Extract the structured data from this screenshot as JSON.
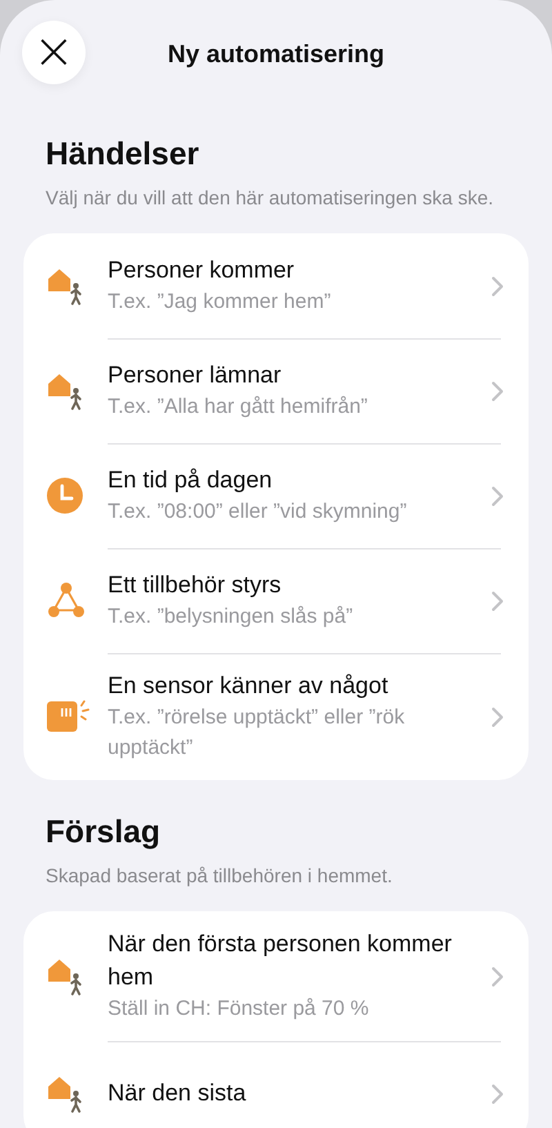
{
  "header": {
    "close_icon": "×",
    "title": "Ny automatisering"
  },
  "sections": [
    {
      "title": "Händelser",
      "subtitle": "Välj när du vill att den här automatiseringen ska ske.",
      "rows": [
        {
          "kind": "person-home",
          "title": "Personer kommer",
          "subtitle": "T.ex. ”Jag kommer hem”"
        },
        {
          "kind": "person-home",
          "title": "Personer lämnar",
          "subtitle": "T.ex. ”Alla har gått hemifrån”"
        },
        {
          "kind": "clock",
          "title": "En tid på dagen",
          "subtitle": "T.ex. ”08:00” eller ”vid skymning”"
        },
        {
          "kind": "accessory",
          "title": "Ett tillbehör styrs",
          "subtitle": "T.ex. ”belysningen slås på”"
        },
        {
          "kind": "sensor",
          "title": "En sensor känner av något",
          "subtitle": "T.ex. ”rörelse upptäckt” eller ”rök upptäckt”"
        }
      ]
    },
    {
      "title": "Förslag",
      "subtitle": "Skapad baserat på tillbehören i hemmet.",
      "rows": [
        {
          "kind": "person-home",
          "title": "När den första personen kommer hem",
          "subtitle": "Ställ in CH: Fönster på 70 %"
        },
        {
          "kind": "person-home",
          "title": "När den sista"
        }
      ]
    }
  ]
}
